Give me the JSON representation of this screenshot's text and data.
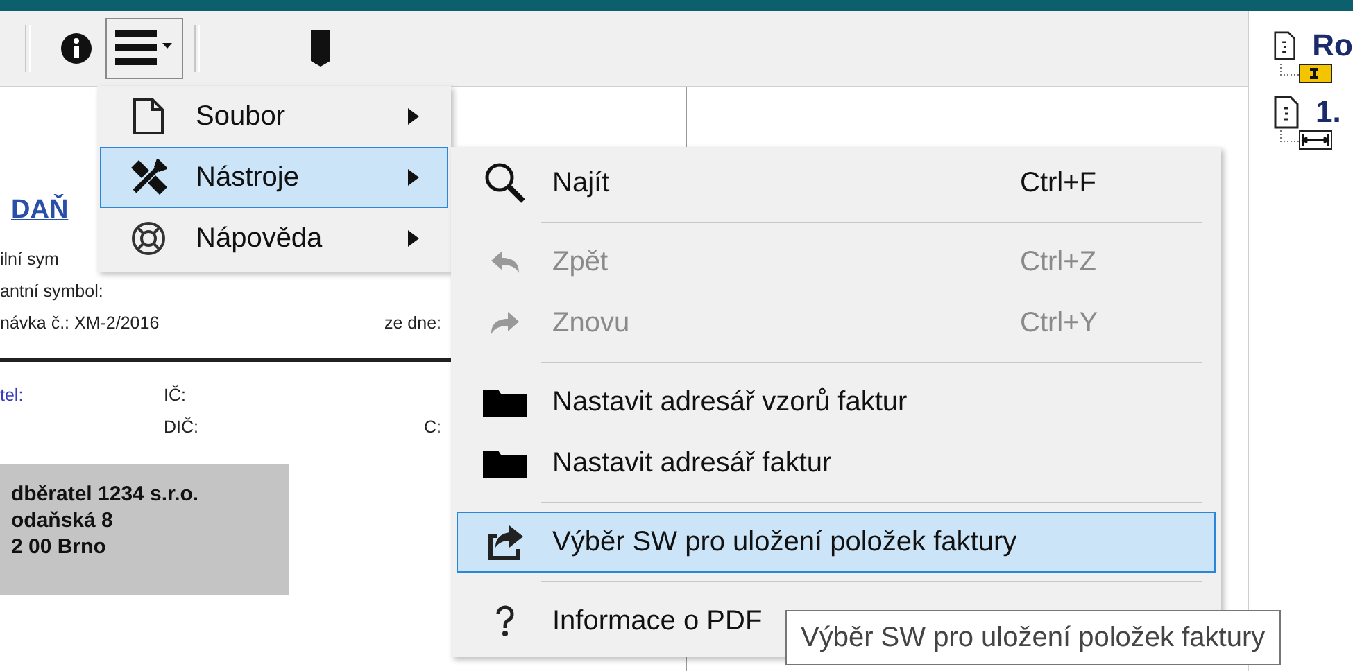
{
  "toolbar": {
    "menu_open": true
  },
  "main_menu": [
    {
      "label": "Soubor",
      "selected": false,
      "submenu": true
    },
    {
      "label": "Nástroje",
      "selected": true,
      "submenu": true
    },
    {
      "label": "Nápověda",
      "selected": false,
      "submenu": true
    }
  ],
  "submenu": [
    {
      "kind": "item",
      "label": "Najít",
      "shortcut": "Ctrl+F",
      "disabled": false,
      "selected": false
    },
    {
      "kind": "separator"
    },
    {
      "kind": "item",
      "label": "Zpět",
      "shortcut": "Ctrl+Z",
      "disabled": true,
      "selected": false
    },
    {
      "kind": "item",
      "label": "Znovu",
      "shortcut": "Ctrl+Y",
      "disabled": true,
      "selected": false
    },
    {
      "kind": "separator"
    },
    {
      "kind": "item",
      "label": "Nastavit adresář vzorů faktur",
      "disabled": false,
      "selected": false
    },
    {
      "kind": "item",
      "label": "Nastavit adresář faktur",
      "disabled": false,
      "selected": false
    },
    {
      "kind": "separator"
    },
    {
      "kind": "item",
      "label": "Výběr SW pro uložení položek faktury",
      "disabled": false,
      "selected": true
    },
    {
      "kind": "separator"
    },
    {
      "kind": "item",
      "label": "Informace o PDF",
      "disabled": false,
      "selected": false
    }
  ],
  "tooltip": "Výběr SW pro uložení položek faktury",
  "document": {
    "title": "DAŇ",
    "lines": [
      {
        "left": "ilní sym"
      },
      {
        "left": "antní symbol:"
      },
      {
        "left": "návka č.: XM-2/2016",
        "right": "ze dne:"
      }
    ],
    "parties": [
      {
        "label": "tel:",
        "field": "IČ:"
      },
      {
        "field": "DIČ:",
        "right": "C:"
      }
    ],
    "address": [
      "dběratel 1234 s.r.o.",
      "odaňská 8",
      "2 00 Brno"
    ]
  },
  "tree": [
    {
      "label": "Ro",
      "children": [
        {
          "kind": "text-field"
        }
      ]
    },
    {
      "label": "1.",
      "children": [
        {
          "kind": "spacer"
        }
      ]
    }
  ]
}
